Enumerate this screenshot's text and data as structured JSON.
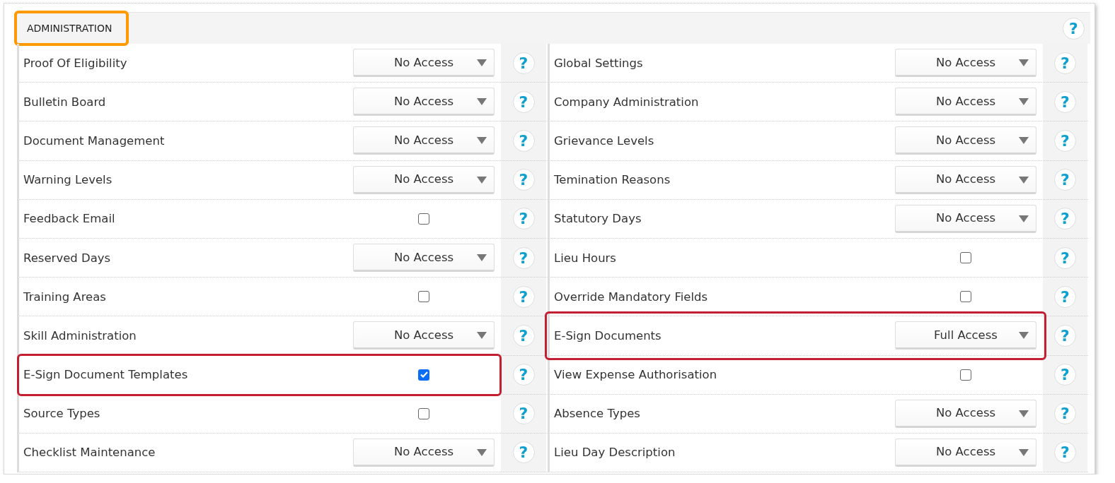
{
  "section": {
    "title": "ADMINISTRATION",
    "title_highlighted": true,
    "help": "?"
  },
  "rows": [
    {
      "left": {
        "label": "Proof Of Eligibility",
        "kind": "select",
        "value": "No Access",
        "highlighted": false,
        "help": "?"
      },
      "right": {
        "label": "Global Settings",
        "kind": "select",
        "value": "No Access",
        "highlighted": false,
        "help": "?"
      }
    },
    {
      "left": {
        "label": "Bulletin Board",
        "kind": "select",
        "value": "No Access",
        "highlighted": false,
        "help": "?"
      },
      "right": {
        "label": "Company Administration",
        "kind": "select",
        "value": "No Access",
        "highlighted": false,
        "help": "?"
      }
    },
    {
      "left": {
        "label": "Document Management",
        "kind": "select",
        "value": "No Access",
        "highlighted": false,
        "help": "?"
      },
      "right": {
        "label": "Grievance Levels",
        "kind": "select",
        "value": "No Access",
        "highlighted": false,
        "help": "?"
      }
    },
    {
      "left": {
        "label": "Warning Levels",
        "kind": "select",
        "value": "No Access",
        "highlighted": false,
        "help": "?"
      },
      "right": {
        "label": "Temination Reasons",
        "kind": "select",
        "value": "No Access",
        "highlighted": false,
        "help": "?"
      }
    },
    {
      "left": {
        "label": "Feedback Email",
        "kind": "checkbox",
        "checked": false,
        "highlighted": false,
        "help": "?"
      },
      "right": {
        "label": "Statutory Days",
        "kind": "select",
        "value": "No Access",
        "highlighted": false,
        "help": "?"
      }
    },
    {
      "left": {
        "label": "Reserved Days",
        "kind": "select",
        "value": "No Access",
        "highlighted": false,
        "help": "?"
      },
      "right": {
        "label": "Lieu Hours",
        "kind": "checkbox",
        "checked": false,
        "highlighted": false,
        "help": "?"
      }
    },
    {
      "left": {
        "label": "Training Areas",
        "kind": "checkbox",
        "checked": false,
        "highlighted": false,
        "help": "?"
      },
      "right": {
        "label": "Override Mandatory Fields",
        "kind": "checkbox",
        "checked": false,
        "highlighted": false,
        "help": "?"
      }
    },
    {
      "left": {
        "label": "Skill Administration",
        "kind": "select",
        "value": "No Access",
        "highlighted": false,
        "help": "?"
      },
      "right": {
        "label": "E-Sign Documents",
        "kind": "select",
        "value": "Full Access",
        "highlighted": true,
        "help": "?"
      }
    },
    {
      "left": {
        "label": "E-Sign Document Templates",
        "kind": "checkbox",
        "checked": true,
        "highlighted": true,
        "help": "?"
      },
      "right": {
        "label": "View Expense Authorisation",
        "kind": "checkbox",
        "checked": false,
        "highlighted": false,
        "help": "?"
      }
    },
    {
      "left": {
        "label": "Source Types",
        "kind": "checkbox",
        "checked": false,
        "highlighted": false,
        "help": "?"
      },
      "right": {
        "label": "Absence Types",
        "kind": "select",
        "value": "No Access",
        "highlighted": false,
        "help": "?"
      }
    },
    {
      "left": {
        "label": "Checklist Maintenance",
        "kind": "select",
        "value": "No Access",
        "highlighted": false,
        "help": "?"
      },
      "right": {
        "label": "Lieu Day Description",
        "kind": "select",
        "value": "No Access",
        "highlighted": false,
        "help": "?"
      }
    }
  ]
}
